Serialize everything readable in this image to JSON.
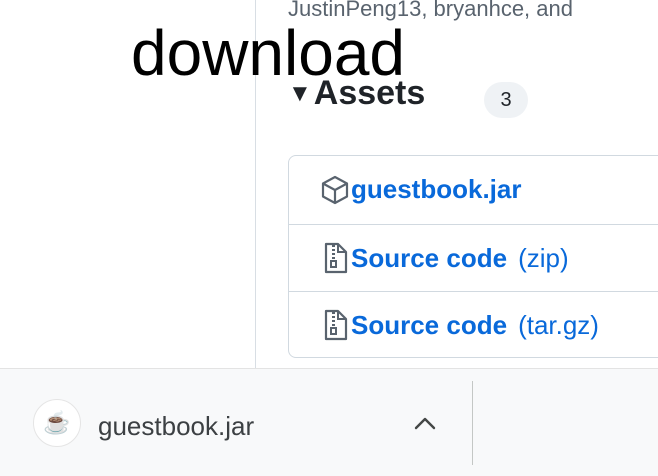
{
  "header": {
    "contributors": "JustinPeng13, bryanhce, and"
  },
  "overlay_label": "download",
  "assets": {
    "title": "Assets",
    "count": "3",
    "items": [
      {
        "name": "guestbook.jar",
        "ext": "",
        "icon": "package-icon"
      },
      {
        "name": "Source code",
        "ext": "(zip)",
        "icon": "file-zip-icon"
      },
      {
        "name": "Source code",
        "ext": "(tar.gz)",
        "icon": "file-zip-icon"
      }
    ]
  },
  "download_bar": {
    "filename": "guestbook.jar",
    "file_icon": "☕",
    "chevron": "chevron-up-icon"
  },
  "colors": {
    "link": "#0969da",
    "text": "#1f2328",
    "muted": "#59636e",
    "border": "#d1d9e0"
  }
}
